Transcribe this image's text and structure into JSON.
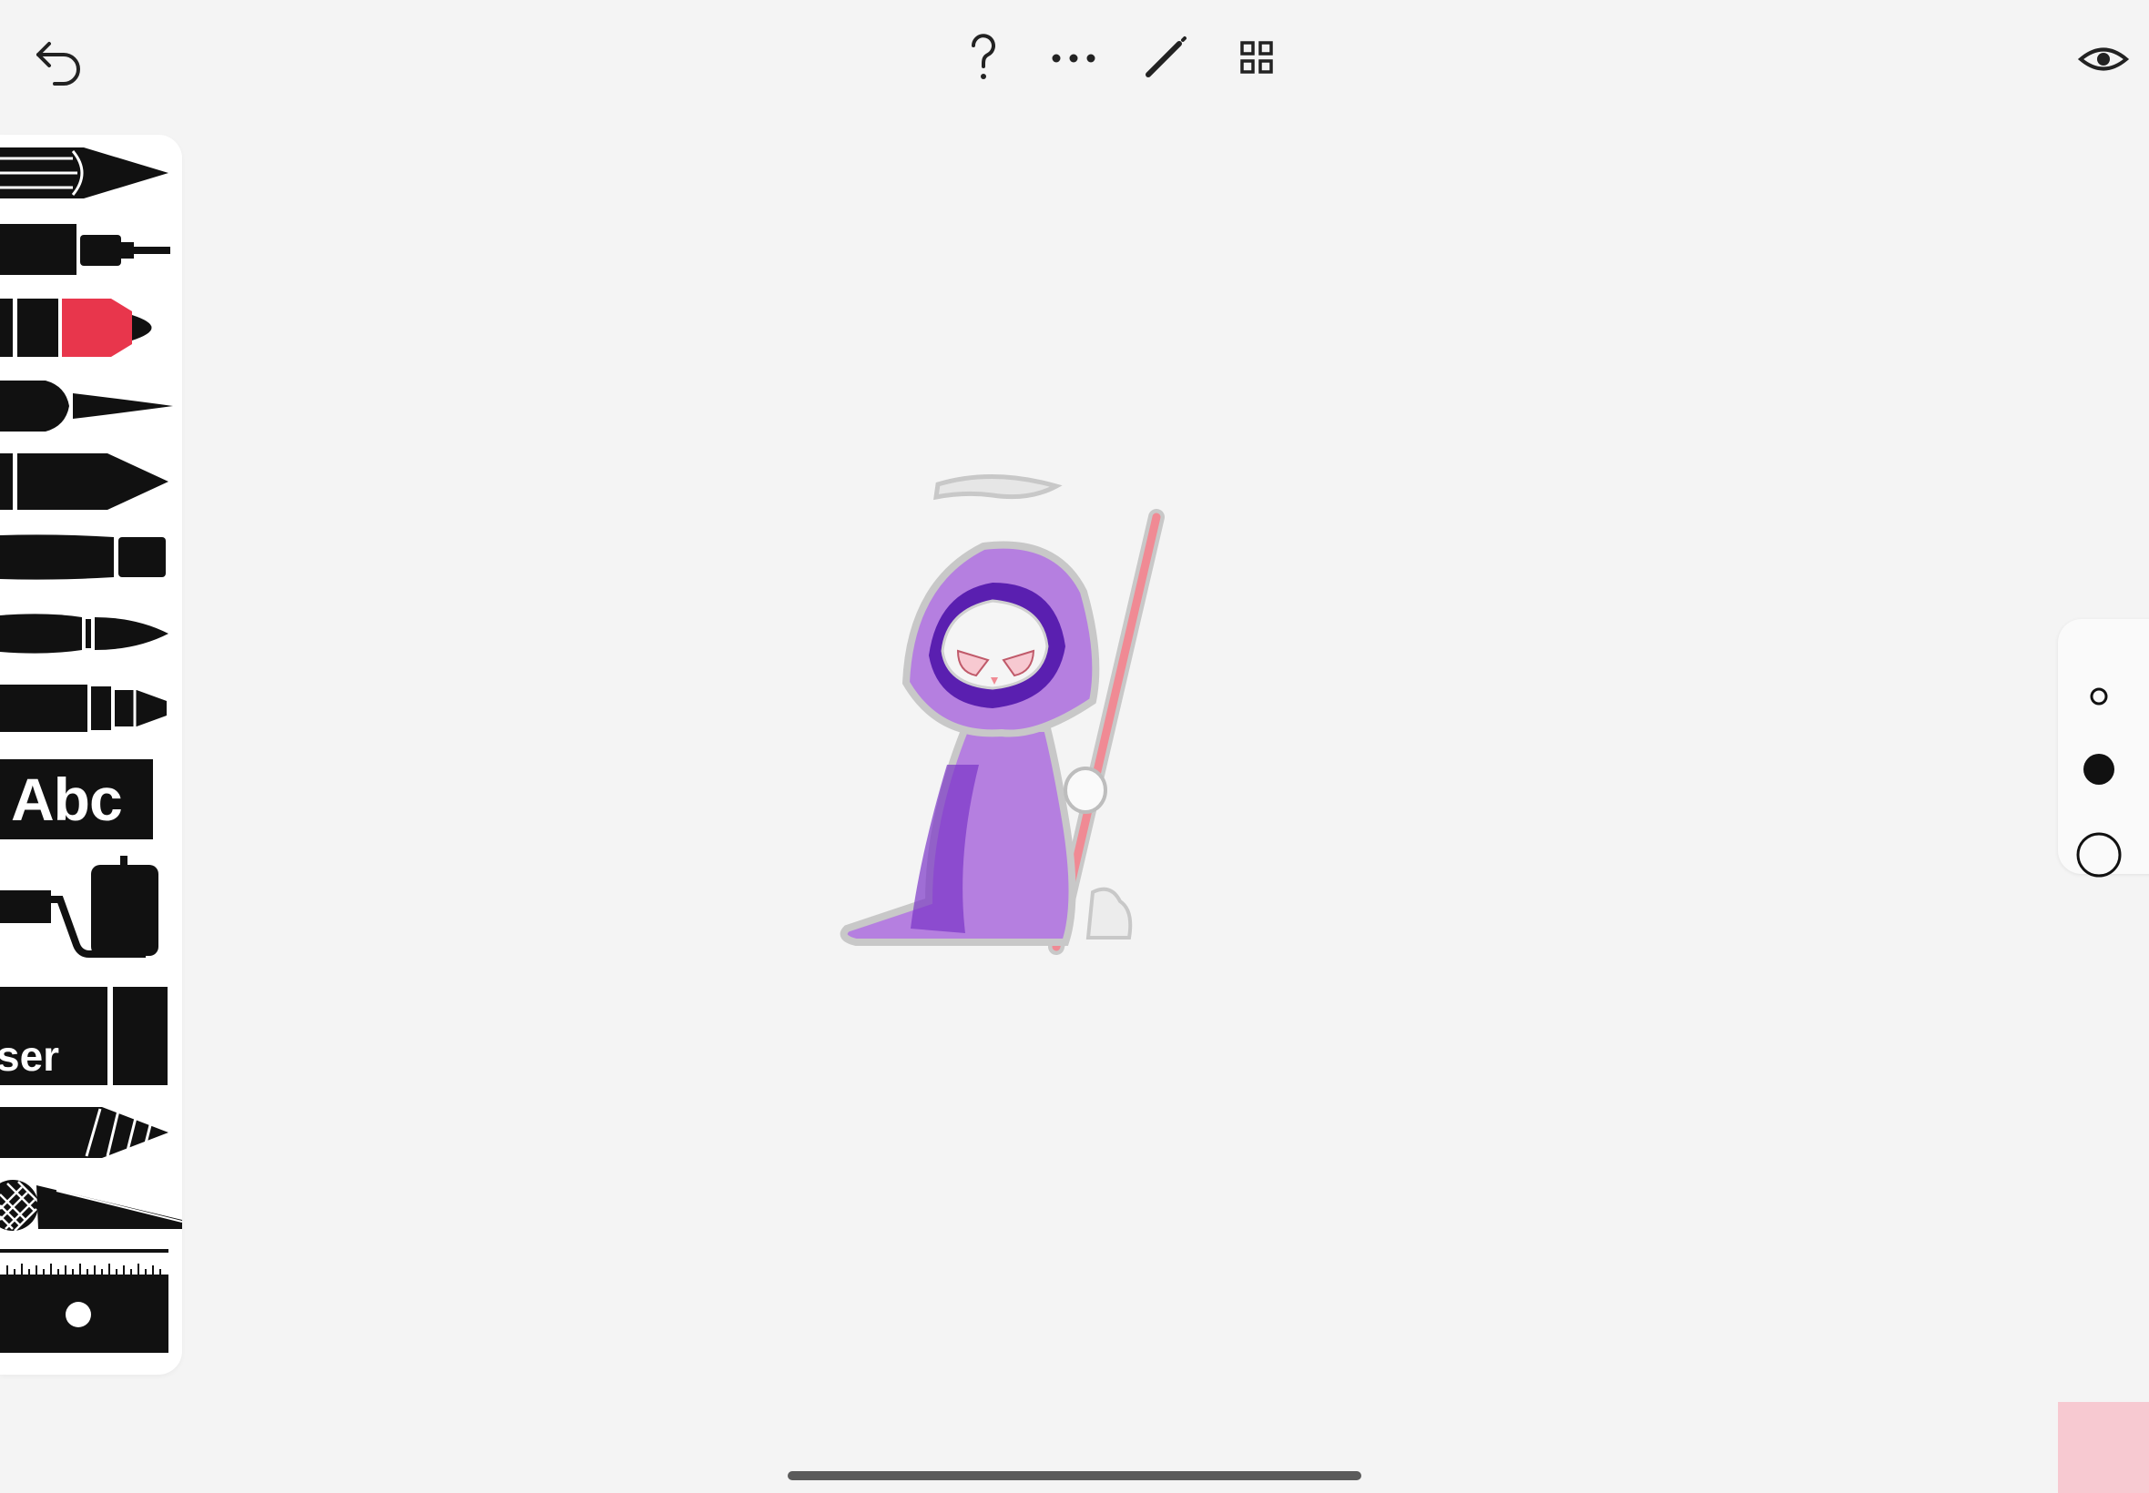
{
  "toolbar": {
    "undo_icon": "undo-arrow-icon",
    "help_icon": "question-mark-icon",
    "more_icon": "ellipsis-icon",
    "draw_icon": "pencil-icon",
    "gallery_icon": "grid-icon",
    "preview_icon": "eye-icon"
  },
  "tools": [
    {
      "name": "fineliner",
      "icon": "fineliner-pen-icon"
    },
    {
      "name": "technical-pen",
      "icon": "technical-pen-icon"
    },
    {
      "name": "marker",
      "icon": "marker-icon",
      "active": true
    },
    {
      "name": "calligraphy",
      "icon": "brush-pen-icon"
    },
    {
      "name": "pencil",
      "icon": "pencil-tool-icon"
    },
    {
      "name": "crayon",
      "icon": "crayon-icon"
    },
    {
      "name": "paintbrush",
      "icon": "paintbrush-icon"
    },
    {
      "name": "felt-tip",
      "icon": "felt-tip-icon"
    },
    {
      "name": "text",
      "label": "Abc",
      "icon": "text-tool-icon"
    },
    {
      "name": "fill",
      "icon": "fill-bucket-icon"
    },
    {
      "name": "eraser",
      "label": "ser",
      "icon": "eraser-icon"
    },
    {
      "name": "smudge",
      "icon": "smudge-icon"
    },
    {
      "name": "cutter",
      "icon": "cutter-icon"
    },
    {
      "name": "ruler",
      "icon": "ruler-icon"
    }
  ],
  "sizes": [
    {
      "name": "small",
      "icon": "small-ring-icon"
    },
    {
      "name": "medium",
      "icon": "filled-dot-icon",
      "selected": true
    },
    {
      "name": "large",
      "icon": "large-ring-icon"
    }
  ],
  "colors": {
    "marker_accent": "#e8364c",
    "current_color": "#f7c9d1",
    "robe": "#b57fe0",
    "robe_dark": "#7a35c8",
    "scythe_handle": "#f08a94"
  }
}
